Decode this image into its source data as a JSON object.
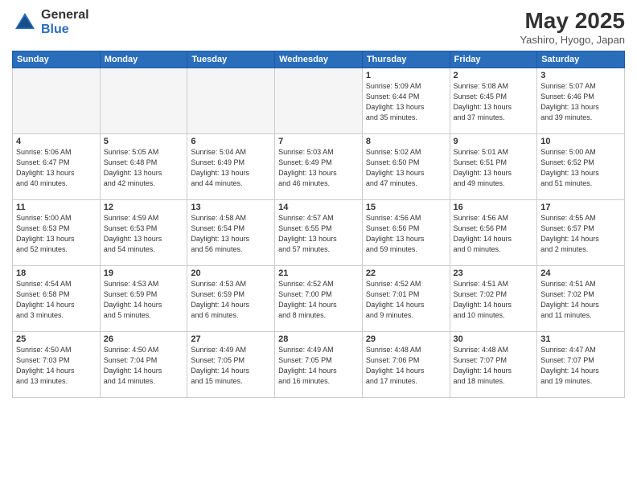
{
  "header": {
    "logo_general": "General",
    "logo_blue": "Blue",
    "title": "May 2025",
    "subtitle": "Yashiro, Hyogo, Japan"
  },
  "weekdays": [
    "Sunday",
    "Monday",
    "Tuesday",
    "Wednesday",
    "Thursday",
    "Friday",
    "Saturday"
  ],
  "weeks": [
    [
      {
        "day": "",
        "info": ""
      },
      {
        "day": "",
        "info": ""
      },
      {
        "day": "",
        "info": ""
      },
      {
        "day": "",
        "info": ""
      },
      {
        "day": "1",
        "info": "Sunrise: 5:09 AM\nSunset: 6:44 PM\nDaylight: 13 hours\nand 35 minutes."
      },
      {
        "day": "2",
        "info": "Sunrise: 5:08 AM\nSunset: 6:45 PM\nDaylight: 13 hours\nand 37 minutes."
      },
      {
        "day": "3",
        "info": "Sunrise: 5:07 AM\nSunset: 6:46 PM\nDaylight: 13 hours\nand 39 minutes."
      }
    ],
    [
      {
        "day": "4",
        "info": "Sunrise: 5:06 AM\nSunset: 6:47 PM\nDaylight: 13 hours\nand 40 minutes."
      },
      {
        "day": "5",
        "info": "Sunrise: 5:05 AM\nSunset: 6:48 PM\nDaylight: 13 hours\nand 42 minutes."
      },
      {
        "day": "6",
        "info": "Sunrise: 5:04 AM\nSunset: 6:49 PM\nDaylight: 13 hours\nand 44 minutes."
      },
      {
        "day": "7",
        "info": "Sunrise: 5:03 AM\nSunset: 6:49 PM\nDaylight: 13 hours\nand 46 minutes."
      },
      {
        "day": "8",
        "info": "Sunrise: 5:02 AM\nSunset: 6:50 PM\nDaylight: 13 hours\nand 47 minutes."
      },
      {
        "day": "9",
        "info": "Sunrise: 5:01 AM\nSunset: 6:51 PM\nDaylight: 13 hours\nand 49 minutes."
      },
      {
        "day": "10",
        "info": "Sunrise: 5:00 AM\nSunset: 6:52 PM\nDaylight: 13 hours\nand 51 minutes."
      }
    ],
    [
      {
        "day": "11",
        "info": "Sunrise: 5:00 AM\nSunset: 6:53 PM\nDaylight: 13 hours\nand 52 minutes."
      },
      {
        "day": "12",
        "info": "Sunrise: 4:59 AM\nSunset: 6:53 PM\nDaylight: 13 hours\nand 54 minutes."
      },
      {
        "day": "13",
        "info": "Sunrise: 4:58 AM\nSunset: 6:54 PM\nDaylight: 13 hours\nand 56 minutes."
      },
      {
        "day": "14",
        "info": "Sunrise: 4:57 AM\nSunset: 6:55 PM\nDaylight: 13 hours\nand 57 minutes."
      },
      {
        "day": "15",
        "info": "Sunrise: 4:56 AM\nSunset: 6:56 PM\nDaylight: 13 hours\nand 59 minutes."
      },
      {
        "day": "16",
        "info": "Sunrise: 4:56 AM\nSunset: 6:56 PM\nDaylight: 14 hours\nand 0 minutes."
      },
      {
        "day": "17",
        "info": "Sunrise: 4:55 AM\nSunset: 6:57 PM\nDaylight: 14 hours\nand 2 minutes."
      }
    ],
    [
      {
        "day": "18",
        "info": "Sunrise: 4:54 AM\nSunset: 6:58 PM\nDaylight: 14 hours\nand 3 minutes."
      },
      {
        "day": "19",
        "info": "Sunrise: 4:53 AM\nSunset: 6:59 PM\nDaylight: 14 hours\nand 5 minutes."
      },
      {
        "day": "20",
        "info": "Sunrise: 4:53 AM\nSunset: 6:59 PM\nDaylight: 14 hours\nand 6 minutes."
      },
      {
        "day": "21",
        "info": "Sunrise: 4:52 AM\nSunset: 7:00 PM\nDaylight: 14 hours\nand 8 minutes."
      },
      {
        "day": "22",
        "info": "Sunrise: 4:52 AM\nSunset: 7:01 PM\nDaylight: 14 hours\nand 9 minutes."
      },
      {
        "day": "23",
        "info": "Sunrise: 4:51 AM\nSunset: 7:02 PM\nDaylight: 14 hours\nand 10 minutes."
      },
      {
        "day": "24",
        "info": "Sunrise: 4:51 AM\nSunset: 7:02 PM\nDaylight: 14 hours\nand 11 minutes."
      }
    ],
    [
      {
        "day": "25",
        "info": "Sunrise: 4:50 AM\nSunset: 7:03 PM\nDaylight: 14 hours\nand 13 minutes."
      },
      {
        "day": "26",
        "info": "Sunrise: 4:50 AM\nSunset: 7:04 PM\nDaylight: 14 hours\nand 14 minutes."
      },
      {
        "day": "27",
        "info": "Sunrise: 4:49 AM\nSunset: 7:05 PM\nDaylight: 14 hours\nand 15 minutes."
      },
      {
        "day": "28",
        "info": "Sunrise: 4:49 AM\nSunset: 7:05 PM\nDaylight: 14 hours\nand 16 minutes."
      },
      {
        "day": "29",
        "info": "Sunrise: 4:48 AM\nSunset: 7:06 PM\nDaylight: 14 hours\nand 17 minutes."
      },
      {
        "day": "30",
        "info": "Sunrise: 4:48 AM\nSunset: 7:07 PM\nDaylight: 14 hours\nand 18 minutes."
      },
      {
        "day": "31",
        "info": "Sunrise: 4:47 AM\nSunset: 7:07 PM\nDaylight: 14 hours\nand 19 minutes."
      }
    ]
  ]
}
